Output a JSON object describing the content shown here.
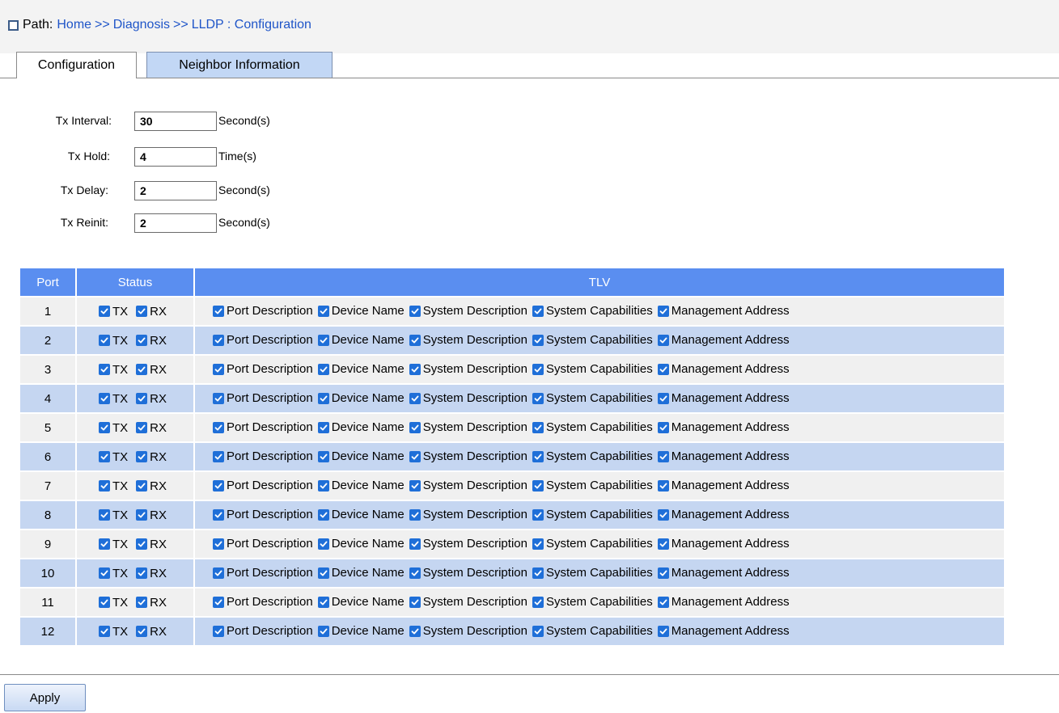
{
  "breadcrumb": {
    "label": "Path:",
    "items": [
      "Home",
      "Diagnosis",
      "LLDP : Configuration"
    ],
    "separator": ">>"
  },
  "tabs": [
    {
      "label": "Configuration",
      "active": true
    },
    {
      "label": "Neighbor Information",
      "active": false
    }
  ],
  "form": [
    {
      "label": "Tx Interval:",
      "value": "30",
      "unit": "Second(s)"
    },
    {
      "label": "Tx Hold:",
      "value": "4",
      "unit": "Time(s)"
    },
    {
      "label": "Tx Delay:",
      "value": "2",
      "unit": "Second(s)"
    },
    {
      "label": "Tx Reinit:",
      "value": "2",
      "unit": "Second(s)"
    }
  ],
  "table": {
    "headers": {
      "port": "Port",
      "status": "Status",
      "tlv": "TLV"
    },
    "status_labels": {
      "tx": "TX",
      "rx": "RX"
    },
    "tlv_labels": {
      "port_description": "Port Description",
      "device_name": "Device Name",
      "system_description": "System Description",
      "system_capabilities": "System Capabilities",
      "management_address": "Management Address"
    },
    "rows": [
      {
        "port": "1"
      },
      {
        "port": "2"
      },
      {
        "port": "3"
      },
      {
        "port": "4"
      },
      {
        "port": "5"
      },
      {
        "port": "6"
      },
      {
        "port": "7"
      },
      {
        "port": "8"
      },
      {
        "port": "9"
      },
      {
        "port": "10"
      },
      {
        "port": "11"
      },
      {
        "port": "12"
      }
    ]
  },
  "apply_label": "Apply",
  "colors": {
    "header_blue": "#5a8ef0",
    "row_alt_blue": "#c5d6f1",
    "row_gray": "#f0f0f0",
    "link_blue": "#1f55c8",
    "checkbox_blue": "#1f6fd8",
    "tab_inactive": "#c2d7f5"
  }
}
